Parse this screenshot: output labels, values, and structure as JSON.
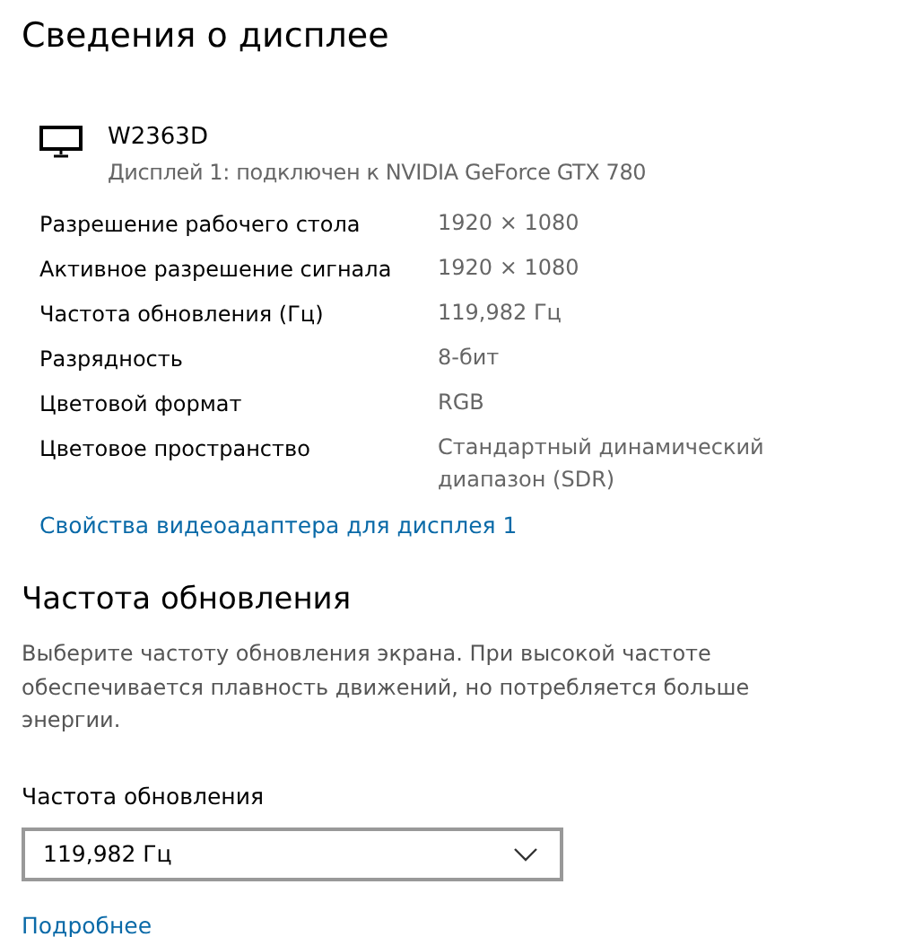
{
  "title": "Сведения о дисплее",
  "display": {
    "name": "W2363D",
    "subtitle": "Дисплей 1: подключен к NVIDIA GeForce GTX 780"
  },
  "properties": [
    {
      "label": "Разрешение рабочего стола",
      "value": "1920 × 1080"
    },
    {
      "label": "Активное разрешение сигнала",
      "value": "1920 × 1080"
    },
    {
      "label": "Частота обновления (Гц)",
      "value": "119,982 Гц"
    },
    {
      "label": "Разрядность",
      "value": "8-бит"
    },
    {
      "label": "Цветовой формат",
      "value": "RGB"
    },
    {
      "label": "Цветовое пространство",
      "value": "Стандартный динамический диапазон (SDR)"
    }
  ],
  "adapter_link": "Свойства видеоадаптера для дисплея 1",
  "refresh": {
    "heading": "Частота обновления",
    "description": "Выберите частоту обновления экрана. При высокой частоте обеспечивается плавность движений, но потребляется больше энергии.",
    "field_label": "Частота обновления",
    "value": "119,982 Гц",
    "link": "Подробнее"
  }
}
